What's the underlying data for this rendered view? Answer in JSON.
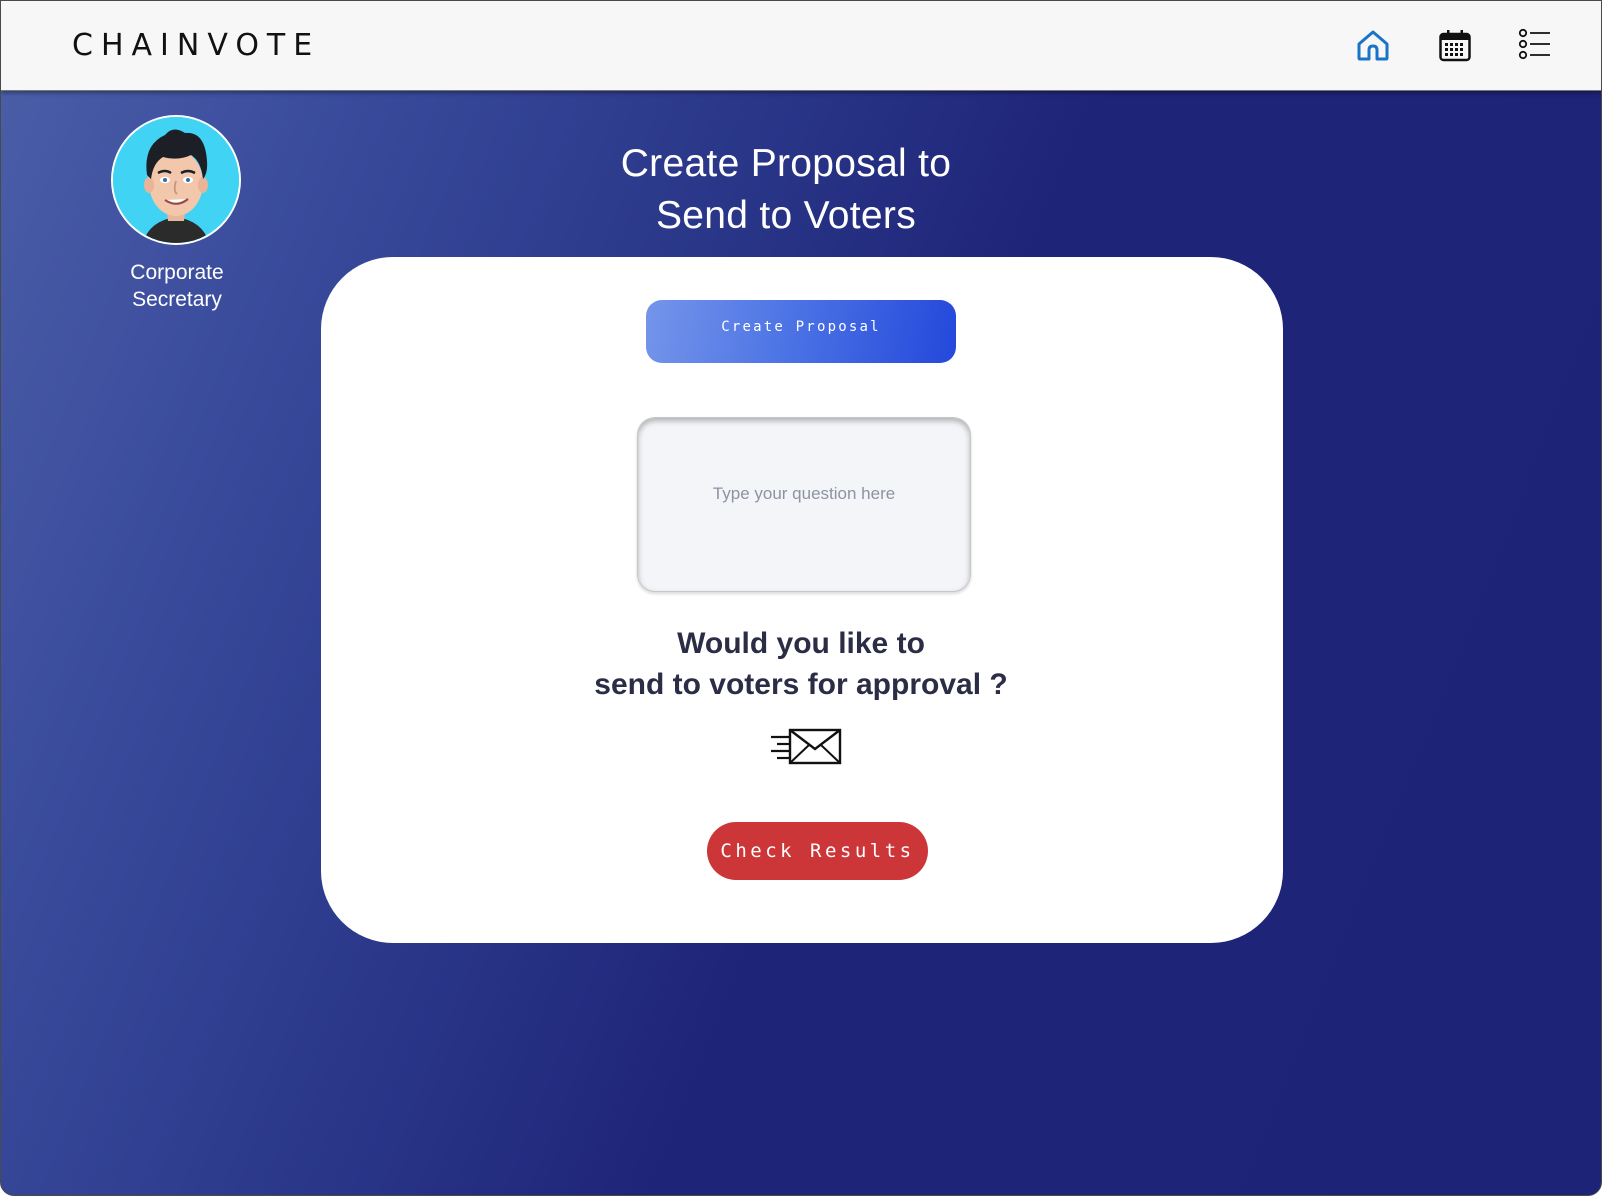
{
  "header": {
    "brand": "CHAINVOTE",
    "nav": [
      {
        "icon": "home-icon",
        "color": "#1a73c8"
      },
      {
        "icon": "calendar-icon",
        "color": "#111111"
      },
      {
        "icon": "list-icon",
        "color": "#111111"
      }
    ]
  },
  "profile": {
    "avatar_icon": "avatar",
    "role_line1": "Corporate",
    "role_line2": "Secretary"
  },
  "main": {
    "title_line1": "Create Proposal to",
    "title_line2": "Send to Voters",
    "create_button": "Create Proposal",
    "question_placeholder": "Type  your question here",
    "prompt_line1": "Would you like to",
    "prompt_line2": "send to voters for approval ?",
    "send_icon": "send-mail-icon",
    "results_button": "Check Results"
  },
  "colors": {
    "accent_blue": "#2448db",
    "results_red": "#cc3638",
    "background_dark": "#1d2377"
  }
}
